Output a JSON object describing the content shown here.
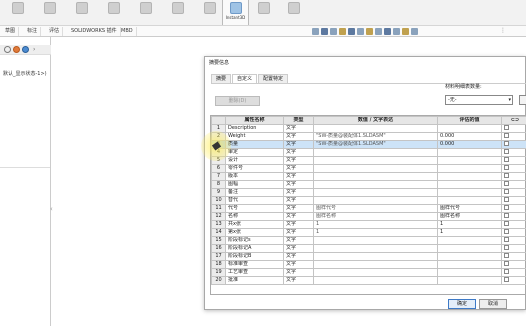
{
  "ribbon": {
    "active_label": "Instant3D"
  },
  "tabs": [
    "草图",
    "标注",
    "评估",
    "SOLIDWORKS 插件",
    "MBD"
  ],
  "left_panel": {
    "tree_text": "默认_显示状态-1>)"
  },
  "dialog": {
    "title": "摘要信息",
    "tabs": [
      "摘要",
      "自定义",
      "配置特定"
    ],
    "delete_button": "删除(D)",
    "material_label": "材料明细表数量:",
    "material_value": "-无-",
    "columns": [
      "",
      "属性名称",
      "类型",
      "数值 / 文字表达",
      "评估的值"
    ],
    "rows": [
      {
        "num": "1",
        "name": "Description",
        "type": "文字",
        "expr": "",
        "val": ""
      },
      {
        "num": "2",
        "name": "Weight",
        "type": "文字",
        "expr": "\"SW-质量@装配体1.SLDASM\"",
        "val": "0.000"
      },
      {
        "num": "3",
        "name": "质量",
        "type": "文字",
        "expr": "\"SW-质量@装配体1.SLDASM\"",
        "val": "0.000"
      },
      {
        "num": "4",
        "name": "审定",
        "type": "文字",
        "expr": "",
        "val": ""
      },
      {
        "num": "5",
        "name": "设计",
        "type": "文字",
        "expr": "",
        "val": ""
      },
      {
        "num": "6",
        "name": "零件号",
        "type": "文字",
        "expr": "",
        "val": ""
      },
      {
        "num": "7",
        "name": "版本",
        "type": "文字",
        "expr": "",
        "val": ""
      },
      {
        "num": "8",
        "name": "图幅",
        "type": "文字",
        "expr": "",
        "val": ""
      },
      {
        "num": "9",
        "name": "备注",
        "type": "文字",
        "expr": "",
        "val": ""
      },
      {
        "num": "10",
        "name": "替代",
        "type": "文字",
        "expr": "",
        "val": ""
      },
      {
        "num": "11",
        "name": "代号",
        "type": "文字",
        "expr": "图样代号",
        "val": "图样代号"
      },
      {
        "num": "12",
        "name": "名称",
        "type": "文字",
        "expr": "图样名称",
        "val": "图样名称"
      },
      {
        "num": "13",
        "name": "共x张",
        "type": "文字",
        "expr": "1",
        "val": "1"
      },
      {
        "num": "14",
        "name": "第x张",
        "type": "文字",
        "expr": "1",
        "val": "1"
      },
      {
        "num": "15",
        "name": "阶段标记s",
        "type": "文字",
        "expr": "",
        "val": ""
      },
      {
        "num": "16",
        "name": "阶段标记A",
        "type": "文字",
        "expr": "",
        "val": ""
      },
      {
        "num": "17",
        "name": "阶段标记B",
        "type": "文字",
        "expr": "",
        "val": ""
      },
      {
        "num": "18",
        "name": "标准审查",
        "type": "文字",
        "expr": "",
        "val": ""
      },
      {
        "num": "19",
        "name": "工艺审查",
        "type": "文字",
        "expr": "",
        "val": ""
      },
      {
        "num": "20",
        "name": "批准",
        "type": "文字",
        "expr": "",
        "val": ""
      }
    ],
    "ok_button": "确定",
    "cancel_button": "取消"
  }
}
